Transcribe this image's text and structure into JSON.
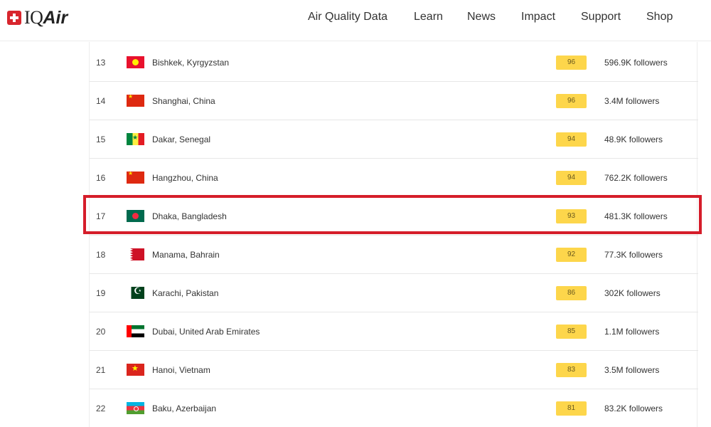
{
  "header": {
    "logo": {
      "text_iq": "IQ",
      "text_air": "Air"
    },
    "nav": [
      "Air Quality Data",
      "Learn",
      "News",
      "Impact",
      "Support",
      "Shop"
    ]
  },
  "ranking": {
    "rows": [
      {
        "rank": "13",
        "city": "Bishkek, Kyrgyzstan",
        "flag": "kyrgyzstan-flag-icon",
        "aqi": "96",
        "followers": "596.9K followers"
      },
      {
        "rank": "14",
        "city": "Shanghai, China",
        "flag": "china-flag-icon",
        "aqi": "96",
        "followers": "3.4M followers"
      },
      {
        "rank": "15",
        "city": "Dakar, Senegal",
        "flag": "senegal-flag-icon",
        "aqi": "94",
        "followers": "48.9K followers"
      },
      {
        "rank": "16",
        "city": "Hangzhou, China",
        "flag": "china-flag-icon",
        "aqi": "94",
        "followers": "762.2K followers"
      },
      {
        "rank": "17",
        "city": "Dhaka, Bangladesh",
        "flag": "bangladesh-flag-icon",
        "aqi": "93",
        "followers": "481.3K followers",
        "highlighted": true
      },
      {
        "rank": "18",
        "city": "Manama, Bahrain",
        "flag": "bahrain-flag-icon",
        "aqi": "92",
        "followers": "77.3K followers"
      },
      {
        "rank": "19",
        "city": "Karachi, Pakistan",
        "flag": "pakistan-flag-icon",
        "aqi": "86",
        "followers": "302K followers"
      },
      {
        "rank": "20",
        "city": "Dubai, United Arab Emirates",
        "flag": "uae-flag-icon",
        "aqi": "85",
        "followers": "1.1M followers"
      },
      {
        "rank": "21",
        "city": "Hanoi, Vietnam",
        "flag": "vietnam-flag-icon",
        "aqi": "83",
        "followers": "3.5M followers"
      },
      {
        "rank": "22",
        "city": "Baku, Azerbaijan",
        "flag": "azerbaijan-flag-icon",
        "aqi": "81",
        "followers": "83.2K followers"
      }
    ]
  },
  "colors": {
    "aqi_badge": "#fdd64b",
    "highlight_border": "#d51d2a",
    "brand_red": "#d8262e"
  }
}
